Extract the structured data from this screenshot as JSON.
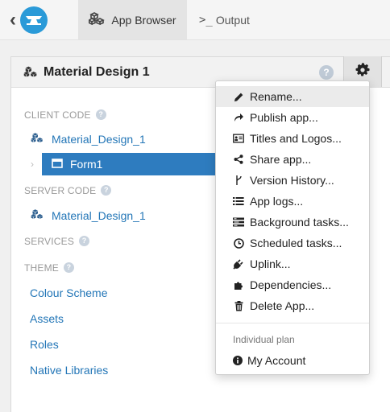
{
  "topbar": {
    "tabs": [
      {
        "label": "App Browser",
        "icon": "cubes-icon"
      },
      {
        "label": "Output",
        "icon": "terminal-icon"
      }
    ]
  },
  "panel": {
    "title": "Material Design 1",
    "sections": {
      "client_code": "CLIENT CODE",
      "server_code": "SERVER CODE",
      "services": "SERVICES",
      "theme": "THEME"
    },
    "client_module": "Material_Design_1",
    "form": "Form1",
    "server_module": "Material_Design_1",
    "theme_links": [
      "Colour Scheme",
      "Assets",
      "Roles",
      "Native Libraries"
    ]
  },
  "menu": {
    "items": [
      {
        "label": "Rename...",
        "icon": "pencil-icon"
      },
      {
        "label": "Publish app...",
        "icon": "share-arrow-icon"
      },
      {
        "label": "Titles and Logos...",
        "icon": "id-card-icon"
      },
      {
        "label": "Share app...",
        "icon": "share-nodes-icon"
      },
      {
        "label": "Version History...",
        "icon": "branch-icon"
      },
      {
        "label": "App logs...",
        "icon": "list-icon"
      },
      {
        "label": "Background tasks...",
        "icon": "tasks-icon"
      },
      {
        "label": "Scheduled tasks...",
        "icon": "clock-icon"
      },
      {
        "label": "Uplink...",
        "icon": "plug-icon"
      },
      {
        "label": "Dependencies...",
        "icon": "puzzle-icon"
      },
      {
        "label": "Delete App...",
        "icon": "trash-icon"
      }
    ],
    "plan_label": "Individual plan",
    "account_label": "My Account"
  },
  "colors": {
    "accent": "#2e7cbf",
    "link": "#2376b7",
    "logo": "#2a9ad8"
  }
}
